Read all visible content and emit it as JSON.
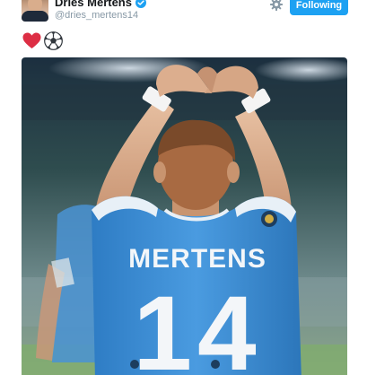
{
  "user": {
    "display_name": "Dries Mertens",
    "handle": "@dries_mertens14",
    "verified": true
  },
  "actions": {
    "follow_label": "Following",
    "follow_color": "#1da1f2"
  },
  "tweet": {
    "emojis": [
      "red-heart-icon",
      "soccer-ball-icon"
    ]
  },
  "photo": {
    "jersey_name": "MERTENS",
    "jersey_number": "14",
    "jersey_color": "#3d8fd6"
  }
}
